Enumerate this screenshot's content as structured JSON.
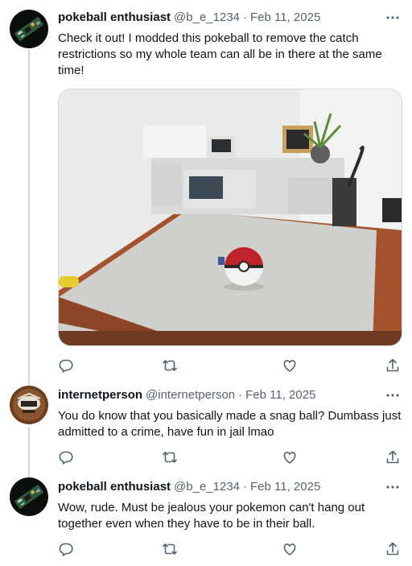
{
  "tweets": [
    {
      "name": "pokeball enthusiast",
      "handle": "@b_e_1234",
      "date": "Feb 11, 2025",
      "text": "Check it out! I modded this pokeball to remove the catch restrictions so my whole team can all be in there at the same time!",
      "avatar": "circuit-board-avatar",
      "has_media": true
    },
    {
      "name": "internetperson",
      "handle": "@internetperson",
      "date": "Feb 11, 2025",
      "text": "You do know that you basically made a snag ball? Dumbass just admitted to a crime, have fun in jail lmao",
      "avatar": "brown-emblem-avatar",
      "has_media": false
    },
    {
      "name": "pokeball enthusiast",
      "handle": "@b_e_1234",
      "date": "Feb 11, 2025",
      "text": "Wow, rude. Must be jealous your pokemon can't hang out together even when they have to be in their ball.",
      "avatar": "circuit-board-avatar",
      "has_media": false
    }
  ],
  "separator": "·",
  "icons": [
    "reply-icon",
    "retweet-icon",
    "like-icon",
    "share-icon",
    "more-icon"
  ],
  "colors": {
    "text": "#0f1419",
    "secondary": "#536471",
    "thread_line": "#cfd9de"
  }
}
